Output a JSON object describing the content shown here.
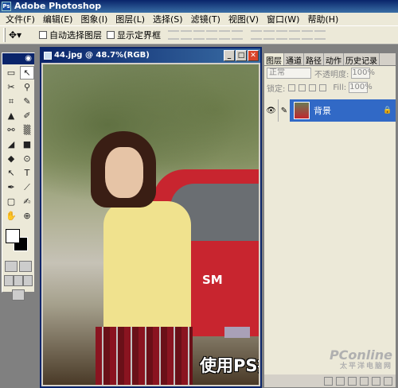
{
  "app": {
    "title": "Adobe Photoshop"
  },
  "menubar": {
    "items": [
      "文件(F)",
      "编辑(E)",
      "图象(I)",
      "图层(L)",
      "选择(S)",
      "滤镜(T)",
      "视图(V)",
      "窗口(W)",
      "帮助(H)"
    ]
  },
  "options": {
    "auto_select_label": "自动选择图层",
    "show_bounds_label": "显示定界框"
  },
  "toolbox": {
    "tools": [
      "▭",
      "↖",
      "✂",
      "⚲",
      "⌗",
      "✎",
      "▲",
      "✐",
      "⚯",
      "▒",
      "◢",
      "■",
      "◆",
      "⊙",
      "↖",
      "T",
      "✒",
      "⟋",
      "▢",
      "✍",
      "✋",
      "⊕"
    ]
  },
  "document": {
    "title": "44.jpg @ 48.7%(RGB)",
    "caption": "使用PS打开图片",
    "car_logo": "SM"
  },
  "layers": {
    "tabs": [
      "图层",
      "通道",
      "路径",
      "动作",
      "历史记录"
    ],
    "blend_mode": "正常",
    "opacity_label": "不透明度:",
    "opacity_value": "100%",
    "lock_label": "锁定:",
    "fill_label": "Fill:",
    "fill_value": "100%",
    "layer_name": "背景"
  },
  "watermark": {
    "brand": "PConline",
    "sub": "太平洋电脑网"
  }
}
